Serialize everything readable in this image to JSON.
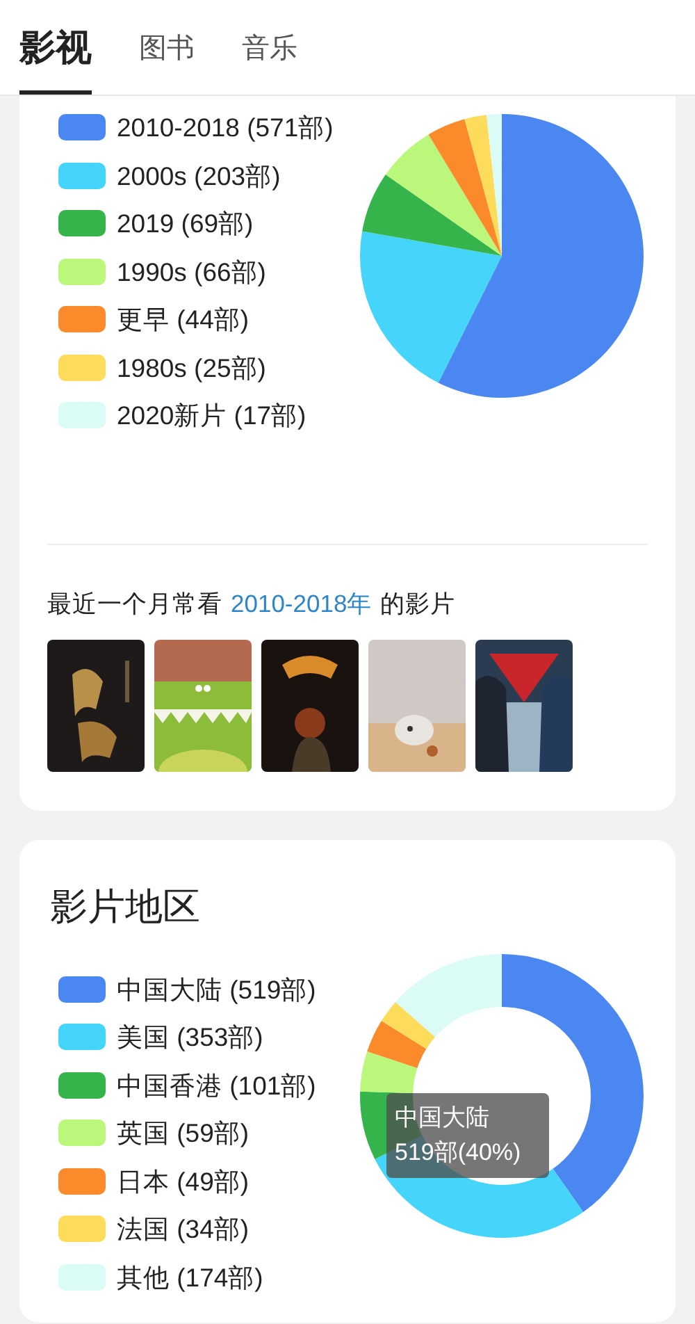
{
  "tabs": [
    {
      "label": "影视",
      "selected": true
    },
    {
      "label": "图书",
      "selected": false
    },
    {
      "label": "音乐",
      "selected": false
    }
  ],
  "decade_card": {
    "legend": [
      {
        "label": "2010-2018 (571部)",
        "color": "#4a87f0"
      },
      {
        "label": "2000s (203部)",
        "color": "#45d5fb"
      },
      {
        "label": "2019 (69部)",
        "color": "#34b44a"
      },
      {
        "label": "1990s (66部)",
        "color": "#bbf77a"
      },
      {
        "label": "更早 (44部)",
        "color": "#fb8a2b"
      },
      {
        "label": "1980s (25部)",
        "color": "#fcdc5a"
      },
      {
        "label": "2020新片 (17部)",
        "color": "#dafbf6"
      }
    ],
    "chart_data": {
      "type": "pie",
      "values": [
        57.39,
        20.4,
        6.93,
        6.63,
        4.42,
        2.51,
        1.72
      ]
    },
    "caption": {
      "before": "最近一个月常看",
      "link": "2010-2018年",
      "after": "的影片"
    }
  },
  "region_card": {
    "title": "影片地区",
    "legend": [
      {
        "label": "中国大陆 (519部)",
        "color": "#4a87f0"
      },
      {
        "label": "美国 (353部)",
        "color": "#45d5fb"
      },
      {
        "label": "中国香港 (101部)",
        "color": "#34b44a"
      },
      {
        "label": "英国 (59部)",
        "color": "#bbf77a"
      },
      {
        "label": "日本 (49部)",
        "color": "#fb8a2b"
      },
      {
        "label": "法国 (34部)",
        "color": "#fcdc5a"
      },
      {
        "label": "其他 (174部)",
        "color": "#dafbf6"
      }
    ],
    "chart_data": {
      "type": "donut",
      "values": [
        40.26,
        27.39,
        7.84,
        4.58,
        3.8,
        2.64,
        13.49
      ]
    },
    "tooltip": {
      "title": "中国大陆",
      "value": "519部(40%)"
    }
  }
}
